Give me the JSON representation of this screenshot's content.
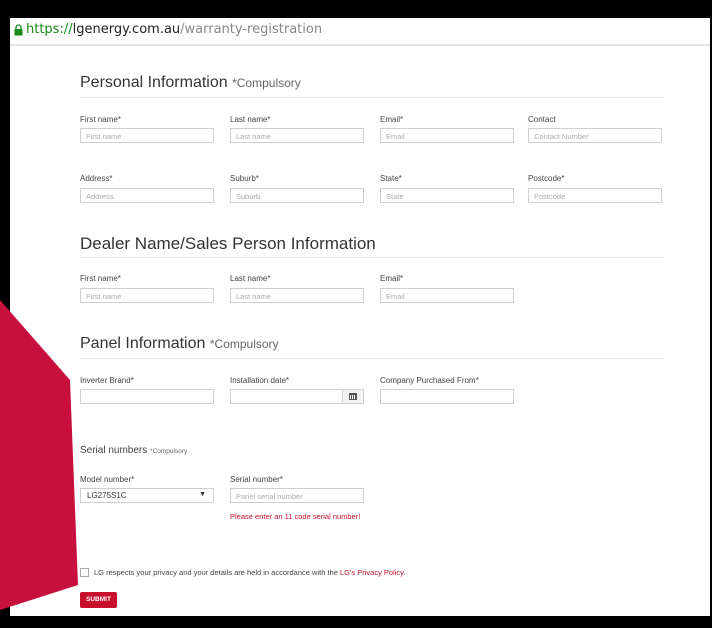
{
  "browser": {
    "url_scheme": "https://",
    "url_host": "lgenergy.com.au",
    "url_path": "/warranty-registration"
  },
  "personal": {
    "title": "Personal Information",
    "note": "*Compulsory",
    "fields": {
      "first_name": {
        "label": "First name*",
        "placeholder": "First name"
      },
      "last_name": {
        "label": "Last name*",
        "placeholder": "Last name"
      },
      "email": {
        "label": "Email*",
        "placeholder": "Email"
      },
      "contact": {
        "label": "Contact",
        "placeholder": "Contact Number"
      },
      "address": {
        "label": "Address*",
        "placeholder": "Address"
      },
      "suburb": {
        "label": "Suburb*",
        "placeholder": "Suburb"
      },
      "state": {
        "label": "State*",
        "placeholder": "State"
      },
      "postcode": {
        "label": "Postcode*",
        "placeholder": "Postcode"
      }
    }
  },
  "dealer": {
    "title": "Dealer Name/Sales Person Information",
    "fields": {
      "first_name": {
        "label": "First name*",
        "placeholder": "First name"
      },
      "last_name": {
        "label": "Last name*",
        "placeholder": "Last name"
      },
      "email": {
        "label": "Email*",
        "placeholder": "Email"
      }
    }
  },
  "panel": {
    "title": "Panel Information",
    "note": "*Compulsory",
    "fields": {
      "inverter_brand": {
        "label": "Inverter Brand*",
        "value": ""
      },
      "installation_date": {
        "label": "Installation date*",
        "value": ""
      },
      "company": {
        "label": "Company Purchased From*",
        "value": ""
      }
    }
  },
  "serial": {
    "title": "Serial numbers",
    "note": "*Compulsory",
    "model_label": "Model number*",
    "model_value": "LG275S1C",
    "serial_label": "Serial number*",
    "serial_placeholder": "Panel serial number",
    "error": "Please enter an 11 code serial number!"
  },
  "privacy": {
    "text": "LG respects your privacy and your details are held in accordance with the",
    "link": "LG's Privacy Policy",
    "end": ".",
    "checked": false
  },
  "submit_label": "SUBMIT",
  "colors": {
    "accent": "#c8102e",
    "pointer": "#c8103e"
  },
  "icons": [
    "lock-icon",
    "calendar-icon",
    "chevron-down-icon",
    "arrow-pointer"
  ]
}
